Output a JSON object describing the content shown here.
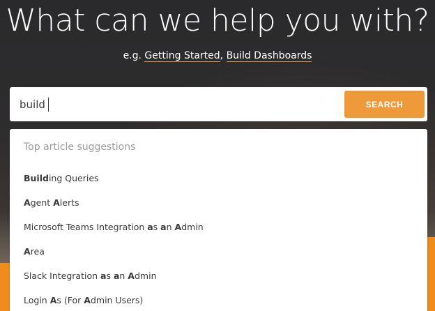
{
  "hero": {
    "title": "What can we help you with?",
    "examples_prefix": "e.g. ",
    "examples": [
      "Getting Started",
      "Build Dashboards"
    ],
    "examples_separator": ", "
  },
  "search": {
    "value": "build",
    "button_label": "SEARCH"
  },
  "suggestions": {
    "heading": "Top article suggestions",
    "items": [
      {
        "parts": [
          {
            "t": "Build",
            "b": true
          },
          {
            "t": "ing Queries",
            "b": false
          }
        ]
      },
      {
        "parts": [
          {
            "t": "A",
            "b": true
          },
          {
            "t": "gent ",
            "b": false
          },
          {
            "t": "A",
            "b": true
          },
          {
            "t": "lerts",
            "b": false
          }
        ]
      },
      {
        "parts": [
          {
            "t": "Microsoft Teams Integration ",
            "b": false
          },
          {
            "t": "a",
            "b": true
          },
          {
            "t": "s ",
            "b": false
          },
          {
            "t": "a",
            "b": true
          },
          {
            "t": "n ",
            "b": false
          },
          {
            "t": "A",
            "b": true
          },
          {
            "t": "dmin",
            "b": false
          }
        ]
      },
      {
        "parts": [
          {
            "t": "A",
            "b": true
          },
          {
            "t": "rea",
            "b": false
          }
        ]
      },
      {
        "parts": [
          {
            "t": "Slack Integration ",
            "b": false
          },
          {
            "t": "a",
            "b": true
          },
          {
            "t": "s ",
            "b": false
          },
          {
            "t": "a",
            "b": true
          },
          {
            "t": "n ",
            "b": false
          },
          {
            "t": "A",
            "b": true
          },
          {
            "t": "dmin",
            "b": false
          }
        ]
      },
      {
        "parts": [
          {
            "t": "Login ",
            "b": false
          },
          {
            "t": "A",
            "b": true
          },
          {
            "t": "s (For ",
            "b": false
          },
          {
            "t": "A",
            "b": true
          },
          {
            "t": "dmin Users)",
            "b": false
          }
        ]
      }
    ]
  },
  "colors": {
    "accent": "#ef9a3a",
    "orange_block": "#f08c1b"
  }
}
